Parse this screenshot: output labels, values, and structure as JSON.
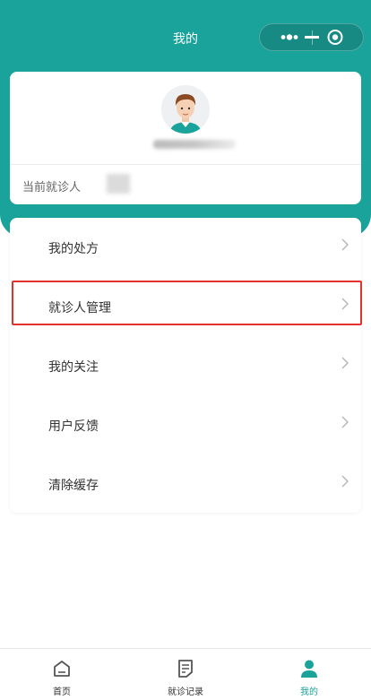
{
  "nav": {
    "title": "我的"
  },
  "colors": {
    "primary": "#1aa39a",
    "highlight": "#e2322b"
  },
  "profile": {
    "avatar_icon": "user-avatar",
    "current_patient_label": "当前就诊人"
  },
  "menu": {
    "items": [
      {
        "label": "我的处方"
      },
      {
        "label": "就诊人管理"
      },
      {
        "label": "我的关注"
      },
      {
        "label": "用户反馈"
      },
      {
        "label": "清除缓存"
      }
    ]
  },
  "tabbar": {
    "items": [
      {
        "label": "首页",
        "icon": "home-icon",
        "active": false
      },
      {
        "label": "就诊记录",
        "icon": "document-icon",
        "active": false
      },
      {
        "label": "我的",
        "icon": "person-icon",
        "active": true
      }
    ]
  }
}
